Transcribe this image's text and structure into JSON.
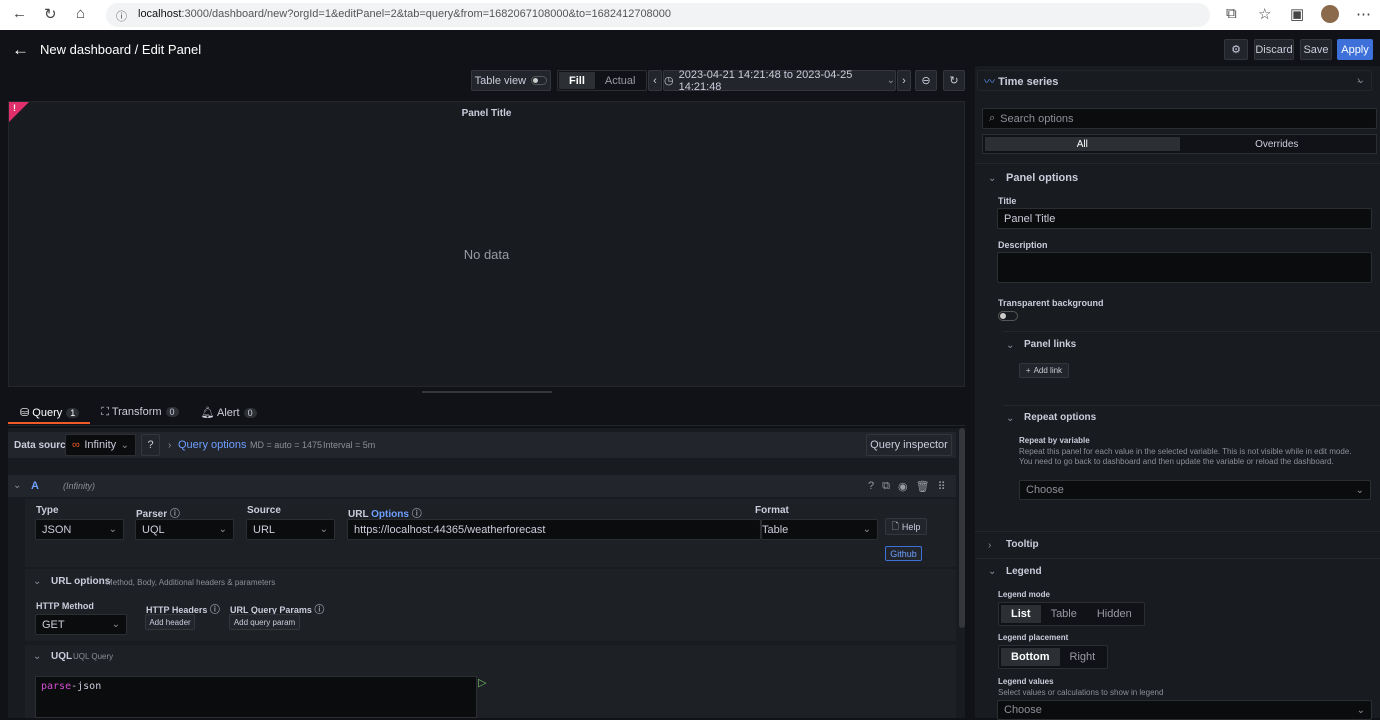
{
  "browser": {
    "url_host": "localhost",
    "url_rest": ":3000/dashboard/new?orgId=1&editPanel=2&tab=query&from=1682067108000&to=1682412708000"
  },
  "header": {
    "title": "New dashboard / Edit Panel",
    "discard": "Discard",
    "save": "Save",
    "apply": "Apply"
  },
  "toolbar": {
    "table_view": "Table view",
    "fill": "Fill",
    "actual": "Actual",
    "time_range": "2023-04-21 14:21:48 to 2023-04-25 14:21:48"
  },
  "panel": {
    "title": "Panel Title",
    "no_data": "No data"
  },
  "tabs": [
    {
      "label": "Query",
      "count": "1"
    },
    {
      "label": "Transform",
      "count": "0"
    },
    {
      "label": "Alert",
      "count": "0"
    }
  ],
  "query": {
    "ds_label": "Data source",
    "ds_value": "Infinity",
    "query_options": "Query options",
    "md": "MD = auto = 1475",
    "interval": "Interval = 5m",
    "inspector": "Query inspector",
    "ref": "A",
    "ref_ds": "(Infinity)",
    "type_label": "Type",
    "type_value": "JSON",
    "parser_label": "Parser",
    "parser_value": "UQL",
    "source_label": "Source",
    "source_value": "URL",
    "url_label": "URL",
    "url_options": "Options",
    "url_value": "https://localhost:44365/weatherforecast",
    "format_label": "Format",
    "format_value": "Table",
    "help": "Help",
    "github": "Github",
    "url_opts_title": "URL options",
    "url_opts_sub": "Method, Body, Additional headers & parameters",
    "http_method_label": "HTTP Method",
    "http_method_value": "GET",
    "http_headers_label": "HTTP Headers",
    "add_header": "Add header",
    "query_params_label": "URL Query Params",
    "add_query_param": "Add query param",
    "uql_title": "UQL",
    "uql_sub": "UQL Query",
    "uql_kw": "parse",
    "uql_rest": "-json"
  },
  "options": {
    "viz": "Time series",
    "search_placeholder": "Search options",
    "tab_all": "All",
    "tab_overrides": "Overrides",
    "panel_options": "Panel options",
    "title_label": "Title",
    "title_value": "Panel Title",
    "description_label": "Description",
    "transparent_label": "Transparent background",
    "panel_links": "Panel links",
    "add_link": "Add link",
    "repeat_options": "Repeat options",
    "repeat_label": "Repeat by variable",
    "repeat_desc": "Repeat this panel for each value in the selected variable. This is not visible while in edit mode. You need to go back to dashboard and then update the variable or reload the dashboard.",
    "choose": "Choose",
    "tooltip": "Tooltip",
    "legend": "Legend",
    "legend_mode_label": "Legend mode",
    "legend_modes": [
      "List",
      "Table",
      "Hidden"
    ],
    "legend_placement_label": "Legend placement",
    "legend_placements": [
      "Bottom",
      "Right"
    ],
    "legend_values_label": "Legend values",
    "legend_values_desc": "Select values or calculations to show in legend"
  },
  "colors": {
    "accent": "#3d71d9",
    "tab_underline": "#f05a28",
    "link": "#6e9fff",
    "keyword": "#d44fd4"
  }
}
